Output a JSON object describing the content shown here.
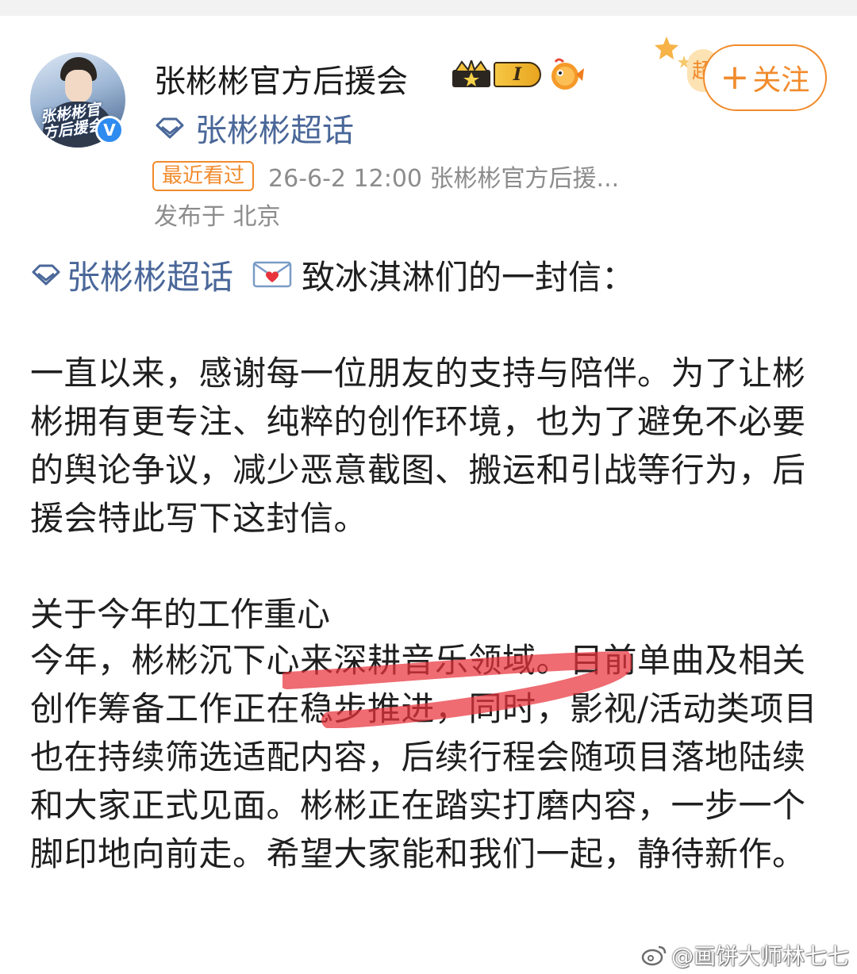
{
  "header": {
    "username": "张彬彬官方后援会",
    "level_badge": "I",
    "topic": "张彬彬超话",
    "follow_label": "关注",
    "avatar_text": "张彬彬官方后援会",
    "verified_mark": "V"
  },
  "meta": {
    "recent_tag": "最近看过",
    "time_source": "26-6-2 12:00   张彬彬官方后援...",
    "location": "发布于 北京"
  },
  "post": {
    "topic": "张彬彬超话",
    "title": "致冰淇淋们的一封信：",
    "paragraph1": "一直以来，感谢每一位朋友的支持与陪伴。为了让彬彬拥有更专注、纯粹的创作环境，也为了避免不必要的舆论争议，减少恶意截图、搬运和引战等行为，后援会特此写下这封信。",
    "section_heading": "关于今年的工作重心",
    "paragraph2": "今年，彬彬沉下心来深耕音乐领域。目前单曲及相关创作筹备工作正在稳步推进，同时，影视/活动类项目也在持续筛选适配内容，后续行程会随项目落地陆续和大家正式见面。彬彬正在踏实打磨内容，一步一个脚印地向前走。希望大家能和我们一起，静待新作。"
  },
  "watermark": "@画饼大师林七七",
  "colors": {
    "accent_orange": "#f18b2c",
    "topic_blue": "#4a6799",
    "meta_gray": "#8c8c8c",
    "highlight_red": "#e8333c"
  },
  "icons": [
    "crown-badge-icon",
    "level-badge-icon",
    "fish-badge-icon",
    "diamond-topic-icon",
    "love-letter-icon",
    "stars-decoration-icon",
    "verified-icon",
    "weibo-logo-icon"
  ]
}
